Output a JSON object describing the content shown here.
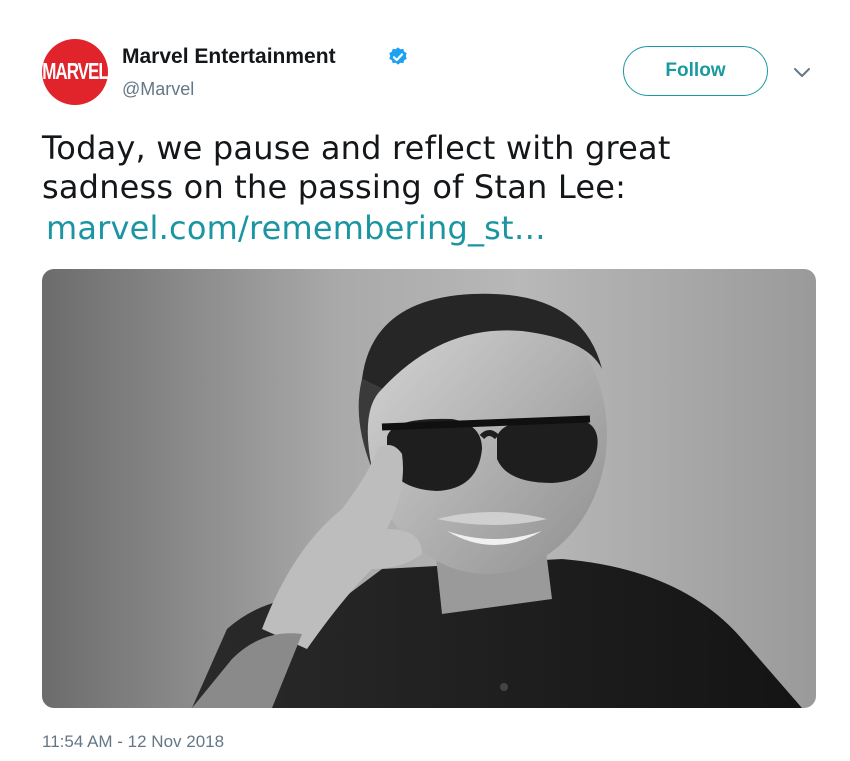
{
  "author": {
    "avatar_wordmark": "MARVEL",
    "name": "Marvel Entertainment",
    "handle": "@Marvel",
    "verified_icon": "verified-badge-icon"
  },
  "actions": {
    "follow_label": "Follow",
    "menu_icon": "chevron-down-icon"
  },
  "tweet": {
    "lines": [
      "Today, we pause and reflect with great",
      "sadness on the passing of Stan Lee:"
    ],
    "link": "marvel.com/remembering_st…"
  },
  "timestamp": "11:54 AM - 12 Nov 2018",
  "colors": {
    "brand_red": "#e1232b",
    "accent_teal": "#1a9aa0",
    "link": "#1b95a2",
    "verified_blue": "#1da1f2",
    "secondary_text": "#657786"
  }
}
